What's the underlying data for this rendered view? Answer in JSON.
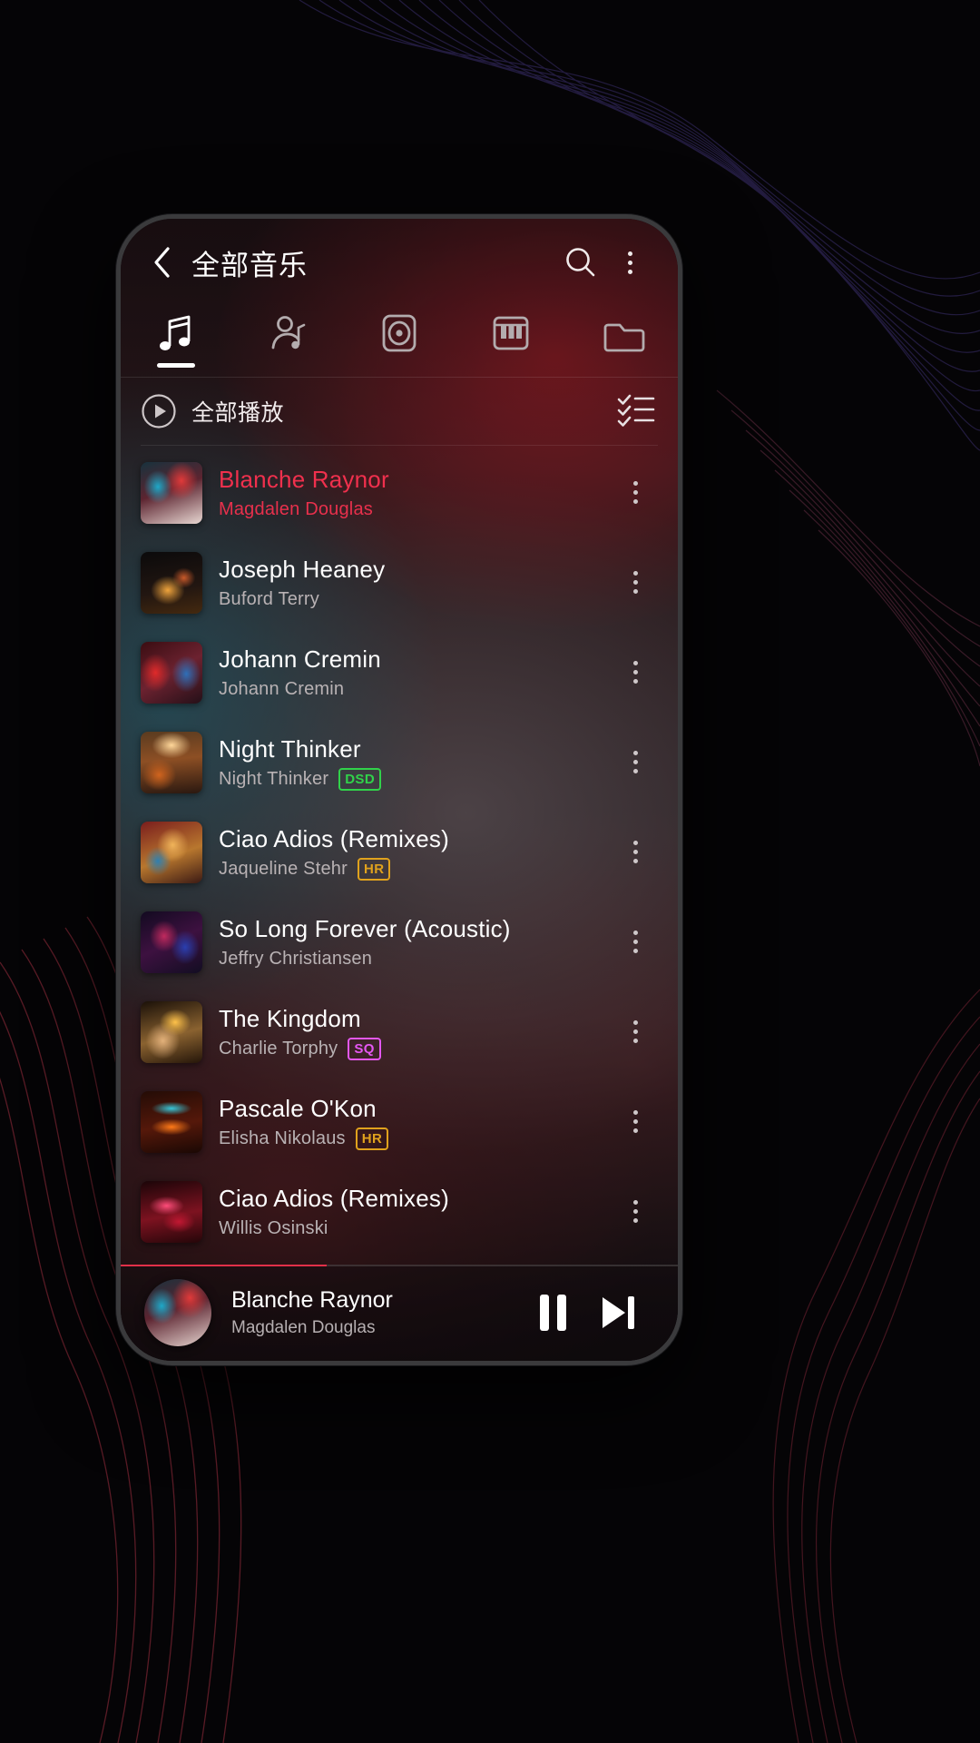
{
  "header": {
    "back_icon": "chevron-left-icon",
    "title": "全部音乐",
    "search_icon": "search-icon",
    "overflow_icon": "more-vertical-icon"
  },
  "tabs": [
    {
      "name": "songs",
      "icon": "music-note-icon",
      "active": true
    },
    {
      "name": "artists",
      "icon": "artist-icon",
      "active": false
    },
    {
      "name": "albums",
      "icon": "album-disc-icon",
      "active": false
    },
    {
      "name": "genres",
      "icon": "piano-keys-icon",
      "active": false
    },
    {
      "name": "folders",
      "icon": "folder-icon",
      "active": false
    }
  ],
  "playall": {
    "icon": "play-circle-icon",
    "label": "全部播放",
    "select_icon": "checklist-icon"
  },
  "songs": [
    {
      "title": "Blanche Raynor",
      "artist": "Magdalen Douglas",
      "badge": "",
      "playing": true,
      "art": "a1"
    },
    {
      "title": "Joseph Heaney",
      "artist": "Buford Terry",
      "badge": "",
      "playing": false,
      "art": "a2"
    },
    {
      "title": "Johann Cremin",
      "artist": "Johann Cremin",
      "badge": "",
      "playing": false,
      "art": "a3"
    },
    {
      "title": "Night Thinker",
      "artist": "Night Thinker",
      "badge": "DSD",
      "playing": false,
      "art": "a4"
    },
    {
      "title": "Ciao Adios (Remixes)",
      "artist": "Jaqueline Stehr",
      "badge": "HR",
      "playing": false,
      "art": "a5"
    },
    {
      "title": "So Long Forever (Acoustic)",
      "artist": "Jeffry Christiansen",
      "badge": "",
      "playing": false,
      "art": "a6"
    },
    {
      "title": "The Kingdom",
      "artist": "Charlie Torphy",
      "badge": "SQ",
      "playing": false,
      "art": "a7"
    },
    {
      "title": "Pascale O'Kon",
      "artist": "Elisha Nikolaus",
      "badge": "HR",
      "playing": false,
      "art": "a8"
    },
    {
      "title": "Ciao Adios (Remixes)",
      "artist": "Willis Osinski",
      "badge": "",
      "playing": false,
      "art": "a9"
    }
  ],
  "badge_colors": {
    "DSD": "#31d24a",
    "HR": "#e0a21d",
    "SQ": "#e457f2"
  },
  "mini_player": {
    "title": "Blanche Raynor",
    "artist": "Magdalen Douglas",
    "pause_icon": "pause-icon",
    "next_icon": "skip-next-icon",
    "row_more_icon": "more-vertical-icon"
  },
  "theme": {
    "accent": "#f0304d",
    "text_primary": "#ffffff",
    "text_secondary": "#b9b2b4",
    "background": "#000000"
  }
}
